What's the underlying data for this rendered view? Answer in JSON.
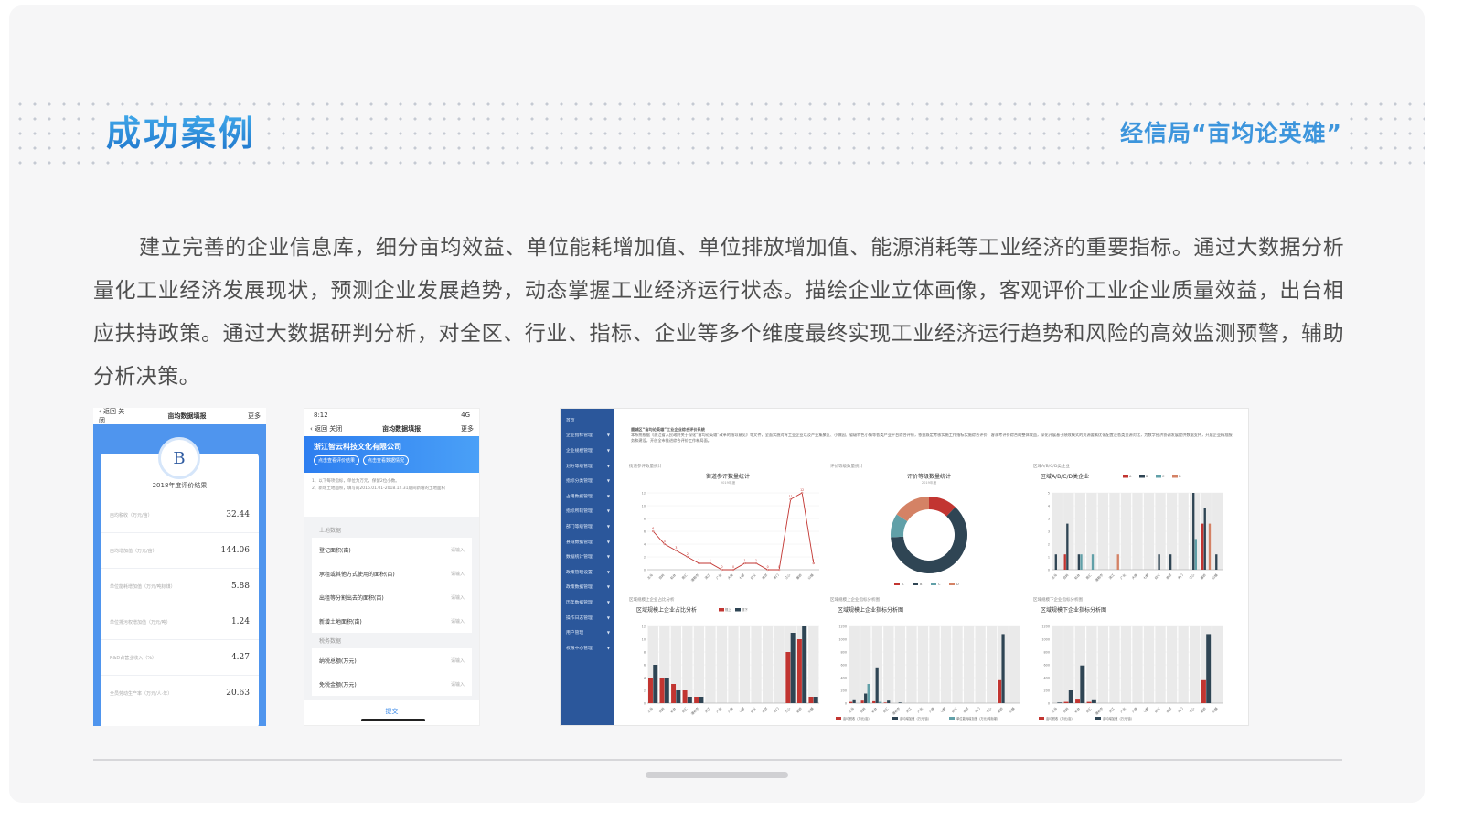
{
  "header": {
    "title": "成功案例",
    "subtitle": "经信局“亩均论英雄”"
  },
  "paragraph": "建立完善的企业信息库，细分亩均效益、单位能耗增加值、单位排放增加值、能源消耗等工业经济的重要指标。通过大数据分析量化工业经济发展现状，预测企业发展趋势，动态掌握工业经济运行状态。描绘企业立体画像，客观评价工业企业质量效益，出台相应扶持政策。通过大数据研判分析，对全区、行业、指标、企业等多个维度最终实现工业经济运行趋势和风险的高效监测预警，辅助分析决策。",
  "colors": {
    "accent": "#1a6fc8",
    "sidebar": "#2b579b",
    "red": "#c23531",
    "dark": "#2f4554",
    "teal": "#61a0a8",
    "orange": "#d48265"
  },
  "phone1": {
    "back": "返回",
    "close": "关闭",
    "title": "亩均数据填报",
    "more": "更多",
    "grade": "B",
    "card_title": "2018年度评价结果",
    "rows": [
      {
        "label": "亩均税收（万元/亩）",
        "value": "32.44"
      },
      {
        "label": "亩均增加值（万元/亩）",
        "value": "144.06"
      },
      {
        "label": "单位能耗增加值（万元/吨标煤）",
        "value": "5.88"
      },
      {
        "label": "单位排污权增加值（万元/吨）",
        "value": "1.24"
      },
      {
        "label": "R&D占营业收入（%）",
        "value": "4.27"
      },
      {
        "label": "全员劳动生产率（万元/人·年）",
        "value": "20.63"
      }
    ]
  },
  "phone2": {
    "time": "8:12",
    "signal": "4G",
    "back": "返回",
    "close": "关闭",
    "title": "亩均数据填报",
    "more": "更多",
    "company": "浙江智云科技文化有限公司",
    "tag1": "点击查看评价结果",
    "tag2": "点击查看数据情况",
    "note1": "1、以下每项指标，单位为万元，保留2位小数。",
    "note2": "2、新增土地面积，填写的2016.01.01-2018.12.31期间新增的土地面积",
    "section1": "土地数据",
    "fields1": [
      "登记面积(亩)",
      "承租或其他方式使用的面积(亩)",
      "出租等分割出去的面积(亩)",
      "新增土地面积(亩)"
    ],
    "section2": "税务数据",
    "fields2": [
      "纳税总额(万元)",
      "免税金额(万元)"
    ],
    "placeholder": "请输入",
    "submit": "提交"
  },
  "dashboard": {
    "sidebar": [
      "首页",
      "企业指标管理",
      "企业规模管理",
      "划分等级管理",
      "指标分类管理",
      "占用数据管理",
      "指标所辖管理",
      "部门等级管理",
      "县域数据管理",
      "数据统计管理",
      "政策管理设置",
      "政策数据管理",
      "历年数据管理",
      "操作日志管理",
      "用户管理",
      "权限中心管理"
    ],
    "intro_title": "鹿城区“亩均论英雄”工业企业综合评价系统",
    "intro_text": "本系统根据《浙江省人民政府关于深化“亩均论英雄”改革的指导意见》等文件，全面实施对有工业企业以及产业集聚区、小微园、省级特色小镇等各类产业平台综合评价，依据既定考核实施工作指标实施综合评价，客观考评价综合的整体效益，深化开展基于绩效模式的资源要素优化配置及各类资源对比，为数字经济协调发展提供数据支持，开展企业精准服务和建设，开创全市推进综合评价工作新局面。",
    "charts": [
      {
        "section": "街道参评数量统计",
        "title": "街道参评数量统计",
        "sub": "2019年度"
      },
      {
        "section": "评价等级数量统计",
        "title": "评价等级数量统计",
        "sub": "2019年度"
      },
      {
        "section": "区域A/B/C/D类企业",
        "title": "区域A/B/C/D类企业"
      },
      {
        "section": "区域规模上企业占比分析",
        "title": "区域规模上企业占比分析"
      },
      {
        "section": "区域规模上企业指标分析图",
        "title": "区域规模上企业指标分析图"
      },
      {
        "section": "区域规模下企业指标分析图",
        "title": "区域规模下企业指标分析图"
      }
    ]
  },
  "chart_data": [
    {
      "type": "line",
      "title": "街道参评数量统计",
      "categories": [
        "五马",
        "双屿",
        "松台",
        "南汇",
        "蒲鞋市",
        "滨江",
        "广化",
        "大南",
        "七都",
        "仰义",
        "南郊",
        "丰门",
        "江心",
        "藤桥",
        "山福"
      ],
      "values": [
        6,
        4,
        3,
        2,
        1,
        1,
        0,
        0,
        1,
        1,
        0,
        0,
        11,
        12,
        1
      ],
      "ylim": [
        0,
        12
      ],
      "grid": true
    },
    {
      "type": "pie",
      "title": "评价等级数量统计",
      "categories": [
        "A",
        "B",
        "C",
        "D"
      ],
      "values": [
        12,
        62,
        10,
        16
      ]
    },
    {
      "type": "bar",
      "title": "区域A/B/C/D类企业",
      "categories": [
        "五马",
        "双屿",
        "松台",
        "南汇",
        "蒲鞋市",
        "滨江",
        "广化",
        "大南",
        "七都",
        "仰义",
        "南郊",
        "丰门",
        "江心",
        "藤桥",
        "山福"
      ],
      "series": [
        {
          "name": "A",
          "values": [
            0,
            1,
            0,
            0,
            0,
            0,
            0,
            0,
            0,
            0,
            0,
            0,
            0,
            3,
            0
          ]
        },
        {
          "name": "B",
          "values": [
            1,
            3,
            1,
            0,
            0,
            0,
            0,
            0,
            0,
            1,
            1,
            0,
            5,
            4,
            1
          ]
        },
        {
          "name": "C",
          "values": [
            0,
            0,
            1,
            1,
            0,
            0,
            0,
            0,
            0,
            0,
            0,
            0,
            2,
            0,
            0
          ]
        },
        {
          "name": "D",
          "values": [
            0,
            0,
            0,
            0,
            0,
            1,
            0,
            0,
            0,
            0,
            0,
            0,
            0,
            3,
            0
          ]
        }
      ],
      "ylim": [
        0,
        5
      ]
    },
    {
      "type": "bar",
      "title": "区域规模上企业占比分析",
      "categories": [
        "五马",
        "双屿",
        "松台",
        "南汇",
        "蒲鞋市",
        "滨江",
        "广化",
        "大南",
        "七都",
        "仰义",
        "南郊",
        "丰门",
        "江心",
        "藤桥",
        "山福"
      ],
      "series": [
        {
          "name": "规上",
          "values": [
            4,
            4,
            3,
            2,
            1,
            0,
            0,
            0,
            0,
            0,
            0,
            0,
            8,
            10,
            1
          ]
        },
        {
          "name": "规下",
          "values": [
            6,
            4,
            2,
            1,
            1,
            0,
            0,
            0,
            0,
            0,
            0,
            0,
            11,
            12,
            1
          ]
        }
      ],
      "ylim": [
        0,
        12
      ]
    },
    {
      "type": "bar",
      "title": "区域规模上企业指标分析图",
      "categories": [
        "五马",
        "双屿",
        "松台",
        "南汇",
        "蒲鞋市",
        "滨江",
        "广化",
        "大南",
        "七都",
        "仰义",
        "南郊",
        "丰门",
        "江心",
        "藤桥",
        "山福"
      ],
      "series": [
        {
          "name": "亩均税收（万元/亩）",
          "values": [
            20,
            40,
            30,
            10,
            0,
            0,
            0,
            0,
            0,
            0,
            0,
            0,
            0,
            360,
            0
          ]
        },
        {
          "name": "亩均增加值（万元/亩）",
          "values": [
            60,
            150,
            560,
            40,
            10,
            0,
            0,
            0,
            0,
            0,
            0,
            0,
            0,
            1080,
            0
          ]
        },
        {
          "name": "单位能耗增加值（万元/吨标煤）",
          "values": [
            0,
            300,
            20,
            0,
            0,
            0,
            0,
            0,
            0,
            0,
            0,
            0,
            0,
            0,
            0
          ]
        }
      ],
      "ylim": [
        0,
        1200
      ]
    },
    {
      "type": "bar",
      "title": "区域规模下企业指标分析图",
      "categories": [
        "五马",
        "双屿",
        "松台",
        "南汇",
        "蒲鞋市",
        "滨江",
        "广化",
        "大南",
        "七都",
        "仰义",
        "南郊",
        "丰门",
        "江心",
        "藤桥",
        "山福"
      ],
      "series": [
        {
          "name": "亩均税收（万元/亩）",
          "values": [
            0,
            20,
            70,
            20,
            0,
            0,
            0,
            0,
            0,
            0,
            0,
            0,
            0,
            360,
            0
          ]
        },
        {
          "name": "亩均增加值（万元/亩）",
          "values": [
            10,
            200,
            590,
            60,
            0,
            0,
            0,
            0,
            0,
            0,
            0,
            0,
            0,
            1080,
            0
          ]
        }
      ],
      "ylim": [
        0,
        1200
      ]
    }
  ]
}
